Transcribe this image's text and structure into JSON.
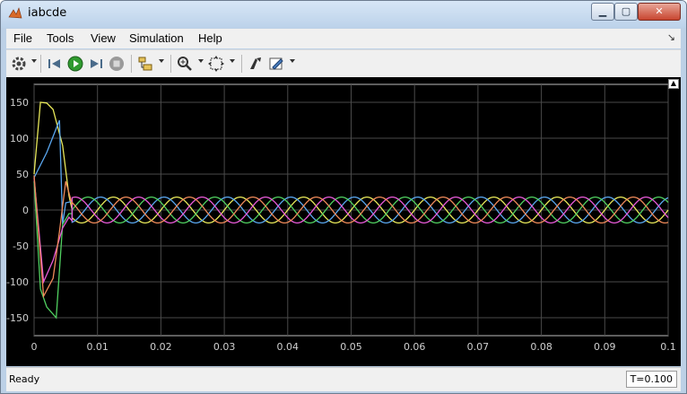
{
  "window": {
    "title": "iabcde"
  },
  "menu": [
    "File",
    "Tools",
    "View",
    "Simulation",
    "Help"
  ],
  "toolbar_icons": [
    "gear-icon",
    "step-back-icon",
    "run-icon",
    "step-forward-icon",
    "stop-icon",
    "signal-selector-icon",
    "zoom-icon",
    "autoscale-icon",
    "style-icon",
    "highlight-icon"
  ],
  "status": {
    "text": "Ready",
    "time": "T=0.100"
  },
  "colors": {
    "background": "#000000",
    "grid": "#4a4a4a",
    "axis_text": "#cfcfcf",
    "phases": [
      "#e8e85a",
      "#5aa7ef",
      "#50d060",
      "#e85ad8",
      "#ef8a5a"
    ]
  },
  "chart_data": {
    "type": "line",
    "title": "",
    "xlabel": "",
    "ylabel": "",
    "xlim": [
      0,
      0.1
    ],
    "ylim": [
      -175,
      175
    ],
    "xticks": [
      0,
      0.01,
      0.02,
      0.03,
      0.04,
      0.05,
      0.06,
      0.07,
      0.08,
      0.09,
      0.1
    ],
    "xtick_labels": [
      "0",
      "0.01",
      "0.02",
      "0.03",
      "0.04",
      "0.05",
      "0.06",
      "0.07",
      "0.08",
      "0.09",
      "0.1"
    ],
    "yticks": [
      150,
      100,
      50,
      0,
      -50,
      -100,
      -150
    ],
    "ytick_labels": [
      "150",
      "100",
      "50",
      "0",
      "-50",
      "-100",
      "-150"
    ],
    "grid": true,
    "series": [
      {
        "color": "#e8e85a",
        "steady_amplitude": 18,
        "frequency_hz": 100,
        "phase_deg": 0,
        "transient": [
          [
            0,
            50
          ],
          [
            0.001,
            150
          ],
          [
            0.002,
            149
          ],
          [
            0.003,
            140
          ],
          [
            0.0045,
            90
          ],
          [
            0.0055,
            20
          ],
          [
            0.006,
            0
          ]
        ]
      },
      {
        "color": "#5aa7ef",
        "steady_amplitude": 18,
        "frequency_hz": 100,
        "phase_deg": 72,
        "transient": [
          [
            0,
            45
          ],
          [
            0.002,
            80
          ],
          [
            0.004,
            125
          ],
          [
            0.0045,
            -20
          ],
          [
            0.005,
            10
          ],
          [
            0.006,
            12
          ]
        ]
      },
      {
        "color": "#50d060",
        "steady_amplitude": 18,
        "frequency_hz": 100,
        "phase_deg": 144,
        "transient": [
          [
            0,
            40
          ],
          [
            0.001,
            -110
          ],
          [
            0.002,
            -135
          ],
          [
            0.0035,
            -150
          ],
          [
            0.0045,
            -20
          ],
          [
            0.0055,
            -5
          ],
          [
            0.006,
            -5
          ]
        ]
      },
      {
        "color": "#e85ad8",
        "steady_amplitude": 18,
        "frequency_hz": 100,
        "phase_deg": 216,
        "transient": [
          [
            0,
            45
          ],
          [
            0.0015,
            -100
          ],
          [
            0.003,
            -70
          ],
          [
            0.0045,
            -25
          ],
          [
            0.0055,
            -10
          ],
          [
            0.006,
            -15
          ]
        ]
      },
      {
        "color": "#ef8a5a",
        "steady_amplitude": 18,
        "frequency_hz": 100,
        "phase_deg": 288,
        "transient": [
          [
            0,
            48
          ],
          [
            0.0015,
            -120
          ],
          [
            0.003,
            -95
          ],
          [
            0.004,
            -30
          ],
          [
            0.005,
            40
          ],
          [
            0.006,
            8
          ]
        ]
      }
    ]
  }
}
